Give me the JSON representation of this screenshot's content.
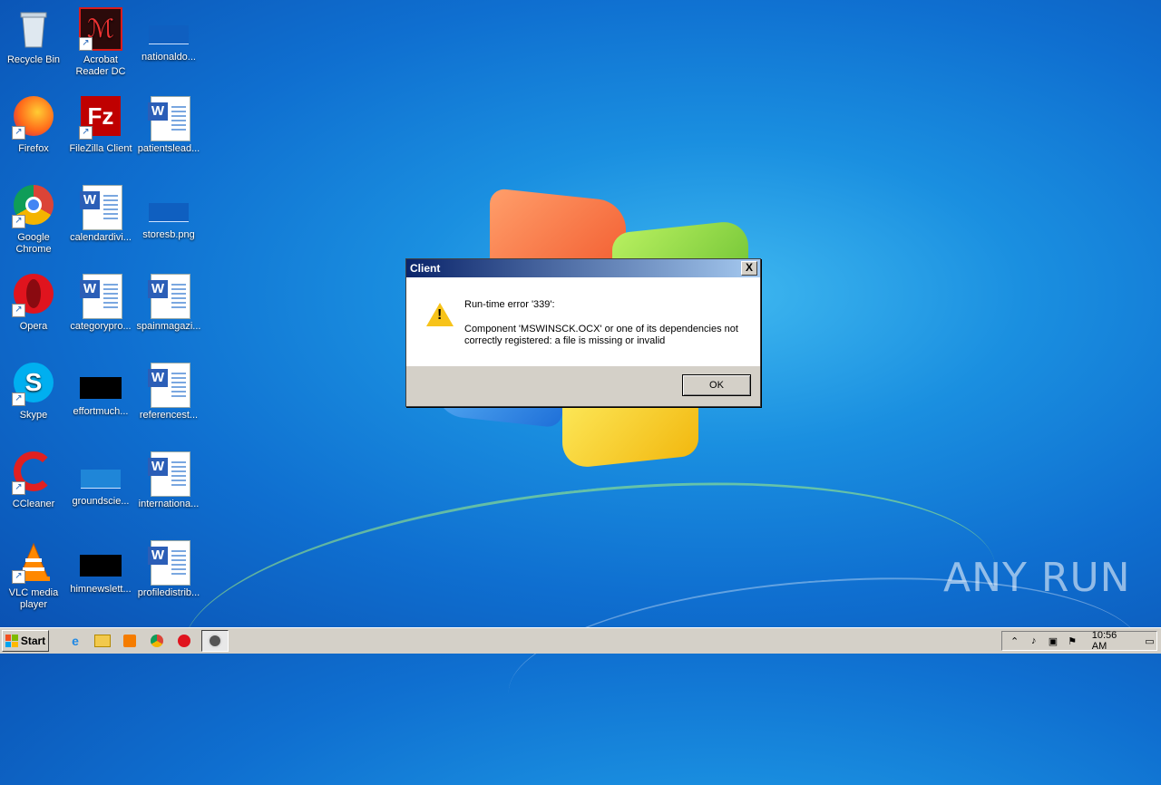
{
  "desktop": {
    "icons": [
      {
        "label": "Recycle Bin",
        "icon": "recycle-bin-icon"
      },
      {
        "label": "Acrobat Reader DC",
        "icon": "acrobat-icon"
      },
      {
        "label": "nationaldo...",
        "icon": "image-file-icon"
      },
      {
        "label": "Firefox",
        "icon": "firefox-icon"
      },
      {
        "label": "FileZilla Client",
        "icon": "filezilla-icon"
      },
      {
        "label": "patientslead...",
        "icon": "word-doc-icon"
      },
      {
        "label": "Google Chrome",
        "icon": "chrome-icon"
      },
      {
        "label": "calendardivi...",
        "icon": "word-doc-icon"
      },
      {
        "label": "storesb.png",
        "icon": "image-file-icon"
      },
      {
        "label": "Opera",
        "icon": "opera-icon"
      },
      {
        "label": "categorypro...",
        "icon": "word-doc-icon"
      },
      {
        "label": "spainmagazi...",
        "icon": "word-doc-icon"
      },
      {
        "label": "Skype",
        "icon": "skype-icon"
      },
      {
        "label": "effortmuch...",
        "icon": "black-file-icon"
      },
      {
        "label": "referencest...",
        "icon": "word-doc-icon"
      },
      {
        "label": "CCleaner",
        "icon": "ccleaner-icon"
      },
      {
        "label": "groundscie...",
        "icon": "image-file-icon"
      },
      {
        "label": "internationa...",
        "icon": "word-doc-icon"
      },
      {
        "label": "VLC media player",
        "icon": "vlc-icon"
      },
      {
        "label": "himnewslett...",
        "icon": "black-file-icon"
      },
      {
        "label": "profiledistrib...",
        "icon": "word-doc-icon"
      }
    ]
  },
  "dialog": {
    "title": "Client",
    "close_label": "X",
    "heading": "Run-time error '339':",
    "message": "Component 'MSWINSCK.OCX' or one of its dependencies not correctly registered: a file is missing or invalid",
    "ok_label": "OK"
  },
  "watermark": "ANY RUN",
  "taskbar": {
    "start_label": "Start",
    "clock": "10:56 AM"
  },
  "colors": {
    "titlebar_start": "#0a246a",
    "titlebar_end": "#a6caf0",
    "warning": "#f7c31a"
  }
}
